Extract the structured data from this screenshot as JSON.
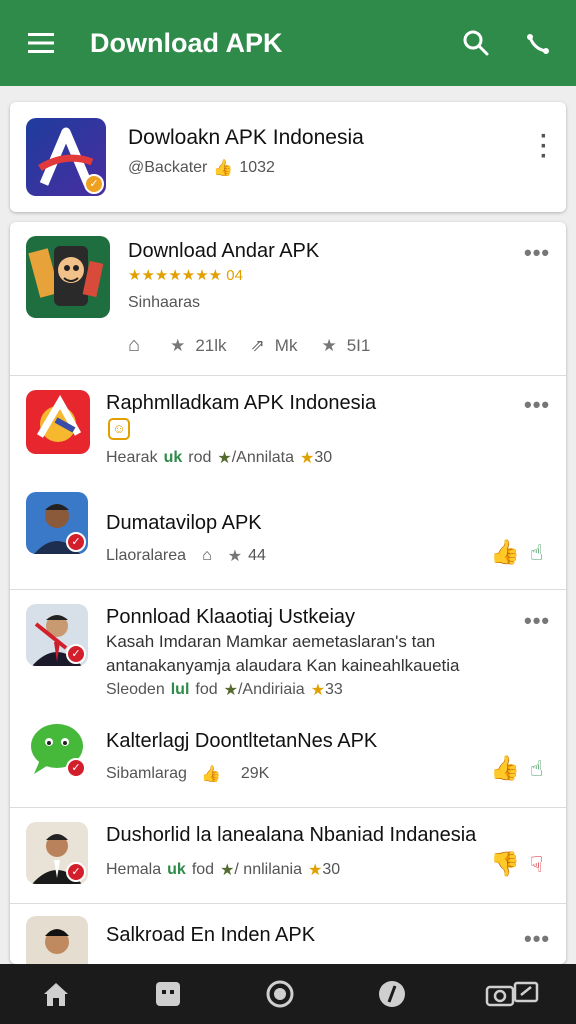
{
  "appbar": {
    "title": "Download APK",
    "menu_icon": "menu-icon",
    "search_icon": "search-icon",
    "share_icon": "share-icon"
  },
  "items": [
    {
      "name": "Dowloakn APK Indonesia",
      "handle": "@Backater",
      "stat": "1032",
      "icon": "a-logo-icon"
    },
    {
      "name": "Download Andar APK",
      "rating": "★★★★★★★ 04",
      "category": "Sinhaaras",
      "actions": {
        "a": "21lk",
        "b": "Mk",
        "c": "5I1"
      }
    },
    {
      "name": "Raphmlladkam APK Indonesia",
      "line": "Hearak",
      "green": "uk",
      "word": "rod",
      "genre": "/Annilata",
      "score": "30"
    },
    {
      "name": "Dumatavilop APK",
      "line": "Llaoralarea",
      "score": "44"
    },
    {
      "name": "Ponnload Klaaotiaj Ustkeiay",
      "desc1": "Kasah Imdaran Mamkar aemetaslaran's tan",
      "desc2": "antanakanyamja alaudara Kan kaineahlkauetia",
      "line": "Sleoden",
      "green": "lul",
      "word": "fod",
      "genre": "/Andiriaia",
      "score": "33"
    },
    {
      "name": "Kalterlagj DoontltetanNes APK",
      "line": "Sibamlarag",
      "score": "29K"
    },
    {
      "name": "Dushorlid la lanealana Nbaniad Indanesia",
      "line": "Hemala",
      "green": "uk",
      "word": "fod",
      "genre": "/ nnlilania",
      "score": "30"
    },
    {
      "name": "Salkroad En Inden APK"
    }
  ],
  "colors": {
    "primary": "#2e8b4a",
    "accent_red": "#d21f2b",
    "star": "#e0a000"
  },
  "bottom_nav": [
    "home-icon",
    "apps-icon",
    "circle-icon",
    "compass-icon",
    "camera-icon"
  ]
}
